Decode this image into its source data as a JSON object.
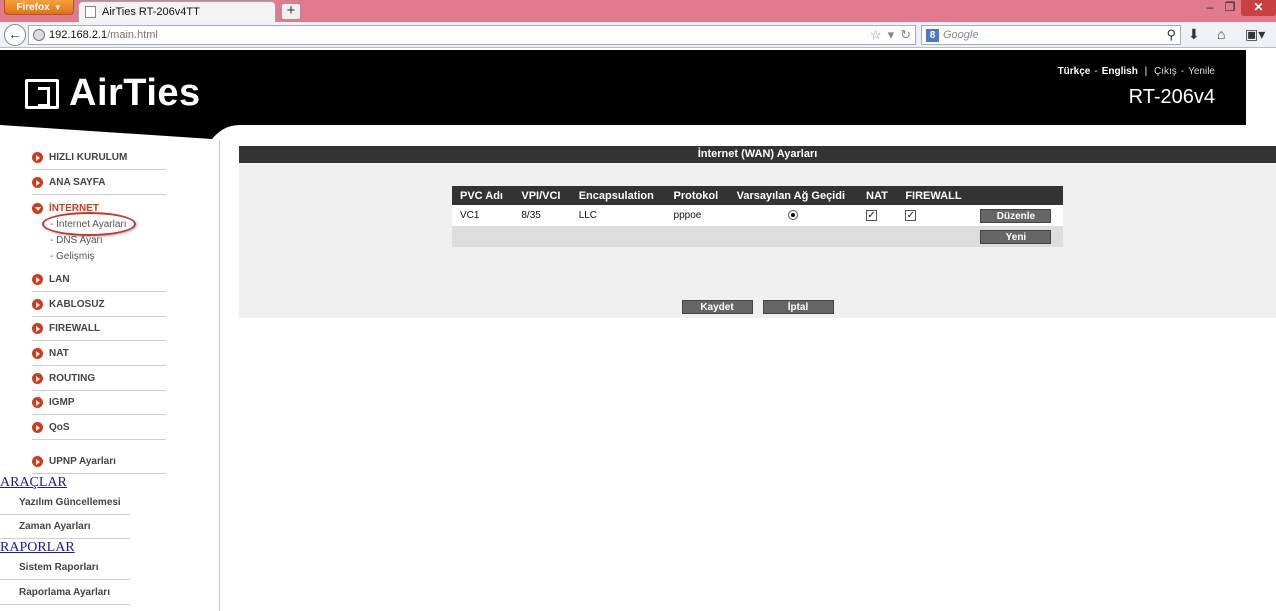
{
  "browser": {
    "menu_button": "Firefox",
    "tab_title": "AirTies RT-206v4TT",
    "new_tab": "+",
    "url_host": "192.168.2.1",
    "url_path": "/main.html",
    "search_placeholder": "Google",
    "search_engine_icon": "8"
  },
  "header": {
    "logo_text": "AirTies",
    "lang_tr": "Türkçe",
    "lang_en": "English",
    "logout": "Çıkış",
    "refresh": "Yenile",
    "model": "RT-206v4"
  },
  "sidebar": {
    "items": [
      {
        "label": "HIZLI KURULUM"
      },
      {
        "label": "ANA SAYFA"
      },
      {
        "label": "İNTERNET"
      },
      {
        "label": "LAN"
      },
      {
        "label": "KABLOSUZ"
      },
      {
        "label": "FIREWALL"
      },
      {
        "label": "NAT"
      },
      {
        "label": "ROUTING"
      },
      {
        "label": "IGMP"
      },
      {
        "label": "QoS"
      },
      {
        "label": "UPNP Ayarları"
      }
    ],
    "internet_sub": [
      "- İnternet Ayarları",
      "- DNS Ayarı",
      "- Gelişmiş"
    ],
    "tools_heading": "ARAÇLAR",
    "tools": [
      "Yazılım Güncellemesi",
      "Zaman Ayarları"
    ],
    "reports_heading": "RAPORLAR",
    "reports": [
      "Sistem Raporları",
      "Raporlama Ayarları"
    ]
  },
  "content": {
    "title": "İnternet (WAN) Ayarları",
    "columns": [
      "PVC Adı",
      "VPI/VCI",
      "Encapsulation",
      "Protokol",
      "Varsayılan Ağ Geçidi",
      "NAT",
      "FIREWALL",
      ""
    ],
    "row": {
      "pvc": "VC1",
      "vpivci": "8/35",
      "encapsulation": "LLC",
      "protocol": "pppoe",
      "default_gateway": true,
      "nat": true,
      "firewall": true
    },
    "edit_button": "Düzenle",
    "new_button": "Yeni",
    "save_button": "Kaydet",
    "cancel_button": "İptal"
  },
  "colors": {
    "accent": "#d33a1a",
    "header_bg": "#000000",
    "table_header": "#333333"
  }
}
